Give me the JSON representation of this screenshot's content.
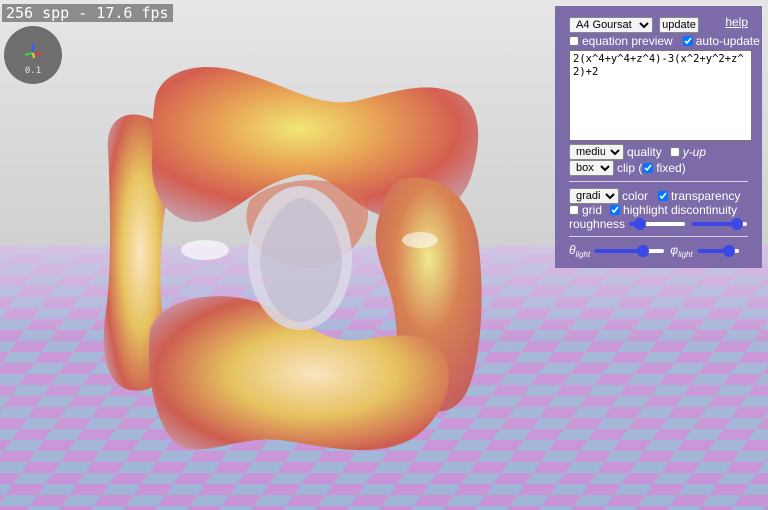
{
  "status": {
    "fps_text": "256 spp - 17.6 fps"
  },
  "axis_widget": {
    "scale": "0.1"
  },
  "panel": {
    "surface_options": [
      "A4 Goursat"
    ],
    "surface_selected": "A4 Goursat",
    "update_label": "update",
    "help_label": "help",
    "equation_preview_label": "equation preview",
    "equation_preview_checked": false,
    "auto_update_label": "auto-update",
    "auto_update_checked": true,
    "equation": "2(x^4+y^4+z^4)-3(x^2+y^2+z^2)+2",
    "quality_options": [
      "medium"
    ],
    "quality_selected": "medium",
    "quality_label": "quality",
    "yup_label": "y-up",
    "yup_checked": false,
    "clip_options": [
      "box"
    ],
    "clip_selected": "box",
    "clip_label": "clip (",
    "fixed_label": "fixed)",
    "fixed_checked": true,
    "color_options": [
      "gradient"
    ],
    "color_selected": "gradient",
    "color_label": "color",
    "transparency_label": "transparency",
    "transparency_checked": true,
    "grid_label": "grid",
    "grid_checked": false,
    "highlight_label": "highlight discontinuity",
    "highlight_checked": true,
    "roughness_label": "roughness",
    "roughness_value": 0.12,
    "roughness2_value": 0.92,
    "theta_symbol": "θ",
    "theta_sub": "light",
    "theta_value": 0.74,
    "phi_symbol": "φ",
    "phi_sub": "light",
    "phi_value": 0.88
  },
  "colors": {
    "panel_bg": "#7d6aa8",
    "slider_fill": "#3b48e6",
    "floor_a": "#c792d6",
    "floor_b": "#9fb4d6"
  }
}
